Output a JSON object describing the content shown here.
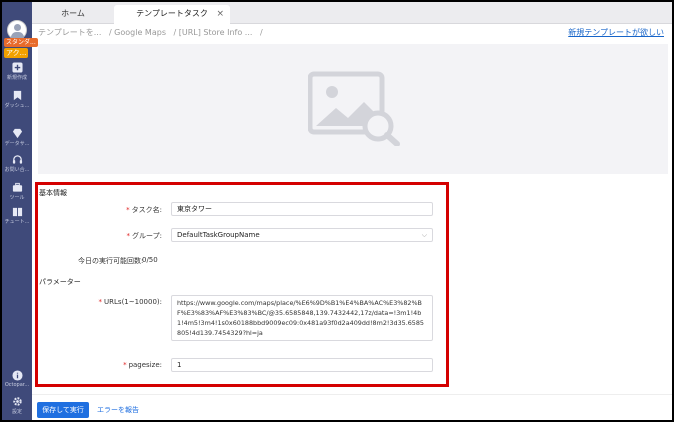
{
  "sidebar": {
    "badge_top": "スタンダ...",
    "badge_account": "アク...",
    "items": [
      {
        "label": "新規作成",
        "icon": "plus-square-icon"
      },
      {
        "label": "ダッシュ...",
        "icon": "bookmark-icon"
      },
      {
        "label": "データサ...",
        "icon": "diamond-icon"
      },
      {
        "label": "お問い合...",
        "icon": "headset-icon"
      },
      {
        "label": "ツール",
        "icon": "toolbox-icon"
      },
      {
        "label": "チュート...",
        "icon": "book-icon"
      },
      {
        "label": "Octopar...",
        "icon": "info-icon"
      },
      {
        "label": "設定",
        "icon": "gear-icon"
      }
    ]
  },
  "tabs": {
    "home": "ホーム",
    "active": "テンプレートタスク",
    "close": "×"
  },
  "breadcrumb": [
    "テンプレートを...",
    "/ Google Maps",
    "/ [URL] Store Info ...",
    "/"
  ],
  "header": {
    "new_template_link": "新規テンプレートが欲しい"
  },
  "form": {
    "basic_title": "基本情報",
    "task_name_label": "タスク名:",
    "task_name_value": "東京タワー",
    "group_label": "グループ:",
    "group_value": "DefaultTaskGroupName",
    "runs_label": "今日の実行可能回数:",
    "runs_value": "0/50",
    "params_title": "パラメーター",
    "urls_label": "URLs(1~10000):",
    "urls_value": "https://www.google.com/maps/place/%E6%9D%B1%E4%BA%AC%E3%82%BF%E3%83%AF%E3%83%BC/@35.6585848,139.7432442,17z/data=!3m1!4b1!4m5!3m4!1s0x60188bbd9009ec09:0x481a93f0d2a409dd!8m2!3d35.6585805!4d139.7454329?hl=ja",
    "pagesize_label": "pagesize:",
    "pagesize_value": "1",
    "required_mark": "*"
  },
  "footer": {
    "save_run": "保存して実行",
    "report_error": "エラーを報告"
  },
  "colors": {
    "sidebar": "#3f4a7a",
    "primary": "#1f6fe0",
    "highlight_border": "#d40000",
    "required": "#e02020"
  }
}
